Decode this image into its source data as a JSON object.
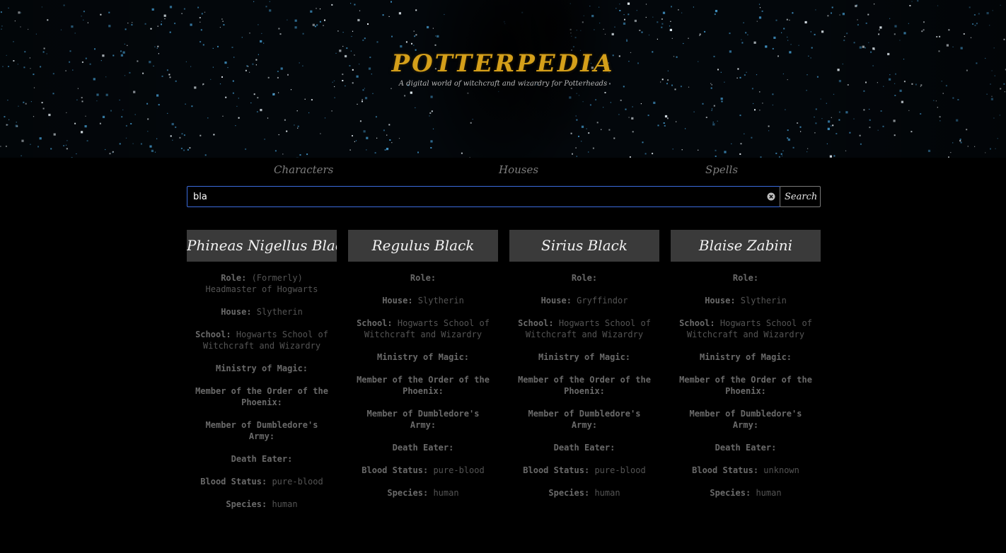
{
  "header": {
    "brand": "POTTERPEDIA",
    "tagline": "A digital world of witchcraft and wizardry for Potterheads"
  },
  "nav": {
    "items": [
      {
        "label": "Characters"
      },
      {
        "label": "Houses"
      },
      {
        "label": "Spells"
      }
    ]
  },
  "search": {
    "value": "bla",
    "button_label": "Search"
  },
  "labels": {
    "role": "Role",
    "house": "House",
    "school": "School",
    "ministry": "Ministry of Magic",
    "order": "Member of the Order of the Phoenix",
    "army": "Member of Dumbledore's Army",
    "death_eater": "Death Eater",
    "blood": "Blood Status",
    "species": "Species"
  },
  "cards": [
    {
      "name": "Phineas Nigellus Black",
      "role": "(Formerly) Headmaster of Hogwarts",
      "house": "Slytherin",
      "school": "Hogwarts School of Witchcraft and Wizardry",
      "ministry": "",
      "order": "",
      "army": "",
      "death_eater": "",
      "blood": "pure-blood",
      "species": "human"
    },
    {
      "name": "Regulus Black",
      "role": "",
      "house": "Slytherin",
      "school": "Hogwarts School of Witchcraft and Wizardry",
      "ministry": "",
      "order": "",
      "army": "",
      "death_eater": "",
      "blood": "pure-blood",
      "species": "human"
    },
    {
      "name": "Sirius Black",
      "role": "",
      "house": "Gryffindor",
      "school": "Hogwarts School of Witchcraft and Wizardry",
      "ministry": "",
      "order": "",
      "army": "",
      "death_eater": "",
      "blood": "pure-blood",
      "species": "human"
    },
    {
      "name": "Blaise Zabini",
      "role": "",
      "house": "Slytherin",
      "school": "Hogwarts School of Witchcraft and Wizardry",
      "ministry": "",
      "order": "",
      "army": "",
      "death_eater": "",
      "blood": "unknown",
      "species": "human"
    }
  ]
}
